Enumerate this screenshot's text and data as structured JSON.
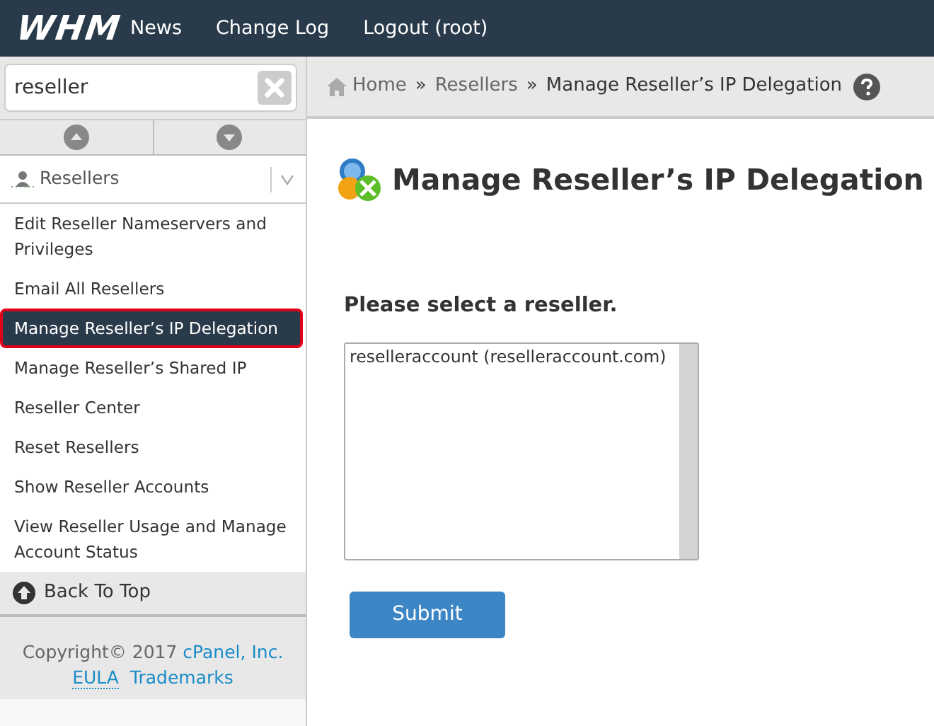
{
  "topbar": {
    "logo": "WHM",
    "links": [
      "News",
      "Change Log",
      "Logout (root)"
    ]
  },
  "sidebar": {
    "search": {
      "value": "reseller"
    },
    "category": {
      "label": "Resellers",
      "expanded": true
    },
    "items": [
      {
        "label": "Edit Reseller Nameservers and Privileges",
        "selected": false
      },
      {
        "label": "Email All Resellers",
        "selected": false
      },
      {
        "label": "Manage Reseller’s IP Delegation",
        "selected": true
      },
      {
        "label": "Manage Reseller’s Shared IP",
        "selected": false
      },
      {
        "label": "Reseller Center",
        "selected": false
      },
      {
        "label": "Reset Resellers",
        "selected": false
      },
      {
        "label": "Show Reseller Accounts",
        "selected": false
      },
      {
        "label": "View Reseller Usage and Manage Account Status",
        "selected": false
      }
    ],
    "back_to_top": "Back To Top",
    "footer": {
      "copyright": "Copyright© 2017",
      "company": "cPanel, Inc.",
      "links": [
        "EULA",
        "Trademarks"
      ]
    }
  },
  "breadcrumb": [
    "Home",
    "Resellers",
    "Manage Reseller’s IP Delegation"
  ],
  "breadcrumb_separator": "»",
  "page": {
    "title": "Manage Reseller’s IP Delegation",
    "prompt": "Please select a reseller.",
    "options": [
      {
        "label": "reselleraccount (reselleraccount.com)",
        "selected": false
      }
    ],
    "submit": "Submit"
  }
}
